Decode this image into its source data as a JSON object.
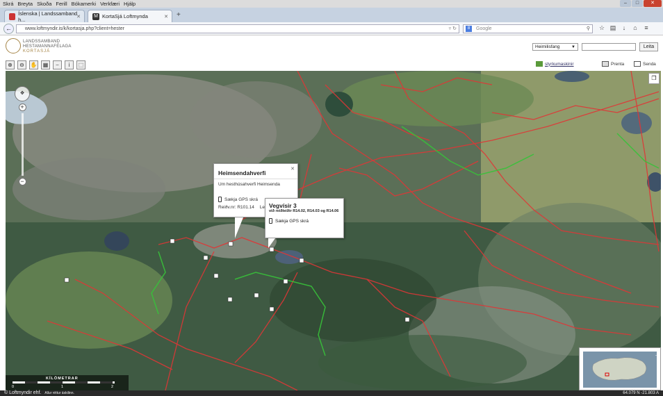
{
  "browser": {
    "menu": [
      "Skrá",
      "Breyta",
      "Skoða",
      "Ferill",
      "Bókamerki",
      "Verkfæri",
      "Hjálp"
    ],
    "tabs": [
      {
        "label": "Íslenska | Landssamband h..."
      },
      {
        "label": "KortaSjá Loftmynda"
      }
    ],
    "url": "www.loftmyndir.is/k/kortasja.php?client=hester",
    "search_placeholder": "Google",
    "window_controls": [
      "minimize-icon",
      "maximize-icon",
      "close-icon"
    ]
  },
  "header": {
    "logo_line1": "LANDSSAMBAND",
    "logo_line2": "HESTAMANNAFÉLAGA",
    "logo_line3": "KORTASJÁ",
    "select_value": "Heimilisfang",
    "search_value": "",
    "search_button": "Leita"
  },
  "toolbar": {
    "tools": [
      "zoom-in-icon",
      "zoom-out-icon",
      "pan-icon",
      "measure-icon",
      "scale-icon",
      "info-icon",
      "select-icon"
    ],
    "links": {
      "styrkumaskinir": "styrkumaskinir",
      "print": "Prenta",
      "send": "Senda"
    }
  },
  "map": {
    "popup1": {
      "title": "Heimsendahverfi",
      "description": "Um hesthúsahverfi Heimsenda",
      "gps_label": "Sækja GPS skrá",
      "ref": "Reiðv.nr: R101.14",
      "length_label": "Leng"
    },
    "popup2": {
      "title": "Vegvísir 3",
      "subtitle": "við reiðleiðir R14.02, R14.03 og R14.06",
      "gps_label": "Sækja GPS skrá"
    },
    "scale": {
      "label": "KÍLÓMETRAR",
      "ticks": [
        "0",
        "1",
        "2"
      ]
    }
  },
  "status": {
    "copyright": "© Loftmyndir ehf.",
    "rights": "Allur réttur áskilinn.",
    "coords": "64.079 N   -21.803 A"
  }
}
